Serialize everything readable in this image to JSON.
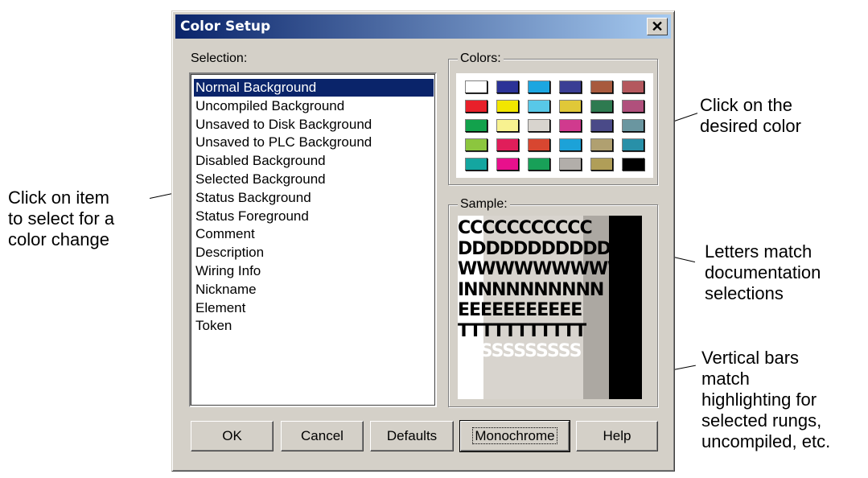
{
  "dialog": {
    "title": "Color Setup",
    "close_glyph": "✕",
    "selection_label": "Selection:",
    "colors_label": "Colors:",
    "sample_label": "Sample:"
  },
  "selection_items": [
    {
      "label": "Normal Background",
      "selected": true
    },
    {
      "label": "Uncompiled Background",
      "selected": false
    },
    {
      "label": "Unsaved to Disk Background",
      "selected": false
    },
    {
      "label": "Unsaved to PLC Background",
      "selected": false
    },
    {
      "label": "Disabled Background",
      "selected": false
    },
    {
      "label": "Selected Background",
      "selected": false
    },
    {
      "label": "Status Background",
      "selected": false
    },
    {
      "label": "Status Foreground",
      "selected": false
    },
    {
      "label": "Comment",
      "selected": false
    },
    {
      "label": "Description",
      "selected": false
    },
    {
      "label": "Wiring Info",
      "selected": false
    },
    {
      "label": "Nickname",
      "selected": false
    },
    {
      "label": "Element",
      "selected": false
    },
    {
      "label": "Token",
      "selected": false
    }
  ],
  "palette": [
    [
      "#ffffff",
      "#2c3397",
      "#1ca6e0",
      "#3a3e94",
      "#a85a3e",
      "#b4585e"
    ],
    [
      "#e8202a",
      "#f2e600",
      "#58c8e8",
      "#e0c838",
      "#2e7a50",
      "#b0507c"
    ],
    [
      "#12a24c",
      "#f8f290",
      "#d8d4ce",
      "#d03a8e",
      "#4a4a88",
      "#6a96a0"
    ],
    [
      "#8cc63e",
      "#e01e5a",
      "#d84630",
      "#1ca2d8",
      "#b0a070",
      "#2890a8"
    ],
    [
      "#14a6a0",
      "#e8108c",
      "#18a058",
      "#b2aeaa",
      "#b09e58",
      "#000000"
    ]
  ],
  "sample": {
    "rows": [
      {
        "text": "CCCCCCCCCCC",
        "color": "#000000"
      },
      {
        "text": "DDDDDDDDDDD",
        "color": "#000000"
      },
      {
        "text": "WWWWWWWWWWW",
        "color": "#000000"
      },
      {
        "text": "INNNNNNNNNN",
        "color": "#000000"
      },
      {
        "text": "EEEEEEEEEEE",
        "color": "#000000"
      },
      {
        "text": "TTTTTTTTTTT",
        "color": "#000000"
      },
      {
        "text": "SSSSSSSSSSS",
        "color": "#ffffff"
      }
    ],
    "bands": [
      "#ffffff",
      "#d8d4ce",
      "#aca8a2",
      "#000000"
    ]
  },
  "buttons": {
    "ok": "OK",
    "cancel": "Cancel",
    "defaults": "Defaults",
    "monochrome": "Monochrome",
    "help": "Help"
  },
  "annotations": {
    "item": [
      "Click on item",
      "to select for a",
      "color change"
    ],
    "color": [
      "Click on the",
      "desired color"
    ],
    "letters": [
      "Letters match",
      "documentation",
      "selections"
    ],
    "bars": [
      "Vertical bars",
      "match",
      "highlighting for",
      "selected rungs,",
      "uncompiled, etc."
    ]
  }
}
